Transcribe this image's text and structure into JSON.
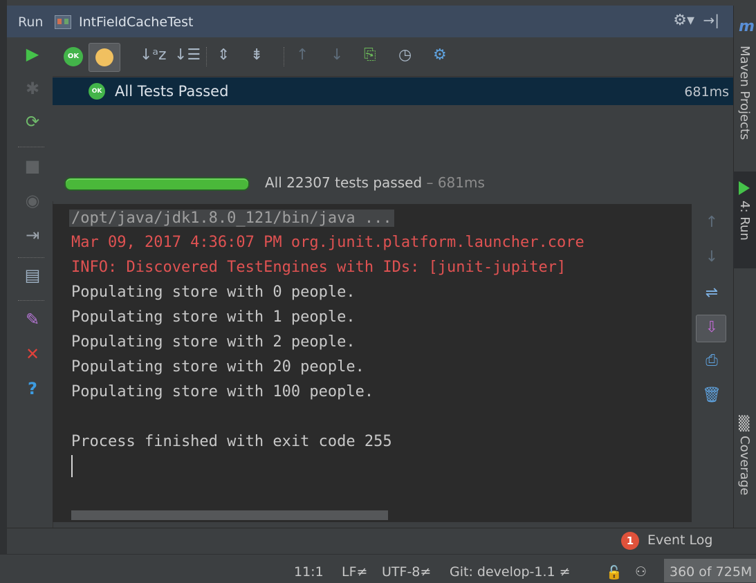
{
  "header": {
    "run_label": "Run",
    "tab_title": "IntFieldCacheTest",
    "gear_icon": "gear-icon",
    "pin_icon": "hide-icon"
  },
  "right_strip": {
    "maven_icon": "m",
    "maven_label": "Maven Projects",
    "run_label": "4: Run",
    "coverage_label": "Coverage"
  },
  "left_toolbar": {
    "icons": [
      "run-icon",
      "debug-icon",
      "rerun-icon",
      "stop-icon",
      "dump-threads-icon",
      "exit-icon",
      "layout-icon",
      "pin-icon",
      "close-icon",
      "help-icon"
    ]
  },
  "top_toolbar": {
    "ok_label": "OK",
    "icons": [
      "show-passed-icon",
      "show-ignored-icon",
      "sort-alpha-icon",
      "sort-duration-icon",
      "expand-all-icon",
      "collapse-all-icon",
      "prev-failed-icon",
      "next-failed-icon",
      "export-icon",
      "history-icon",
      "settings-icon"
    ]
  },
  "test_tree": {
    "ok_label": "OK",
    "label": "All Tests Passed",
    "time": "681ms"
  },
  "progress": {
    "fraction": 1.0,
    "label": "All 22307 tests passed",
    "time": "– 681ms"
  },
  "console": {
    "command": "/opt/java/jdk1.8.0_121/bin/java ...",
    "lines": [
      {
        "text": "Mar 09, 2017 4:36:07 PM org.junit.platform.launcher.core",
        "color": "#e05252"
      },
      {
        "text": "INFO: Discovered TestEngines with IDs: [junit-jupiter]",
        "color": "#e05252"
      },
      {
        "text": "Populating store with 0 people.",
        "color": "#c8c8c8"
      },
      {
        "text": "Populating store with 1 people.",
        "color": "#c8c8c8"
      },
      {
        "text": "Populating store with 2 people.",
        "color": "#c8c8c8"
      },
      {
        "text": "Populating store with 20 people.",
        "color": "#c8c8c8"
      },
      {
        "text": "Populating store with 100 people.",
        "color": "#c8c8c8"
      }
    ],
    "exit_line": "Process finished with exit code 255"
  },
  "event_log": {
    "count": "1",
    "label": "Event Log"
  },
  "status_bar": {
    "position": "11:1",
    "line_sep": "LF≠",
    "encoding": "UTF-8≠",
    "git": "Git: develop-1.1 ≠",
    "memory": "360 of 725M"
  }
}
